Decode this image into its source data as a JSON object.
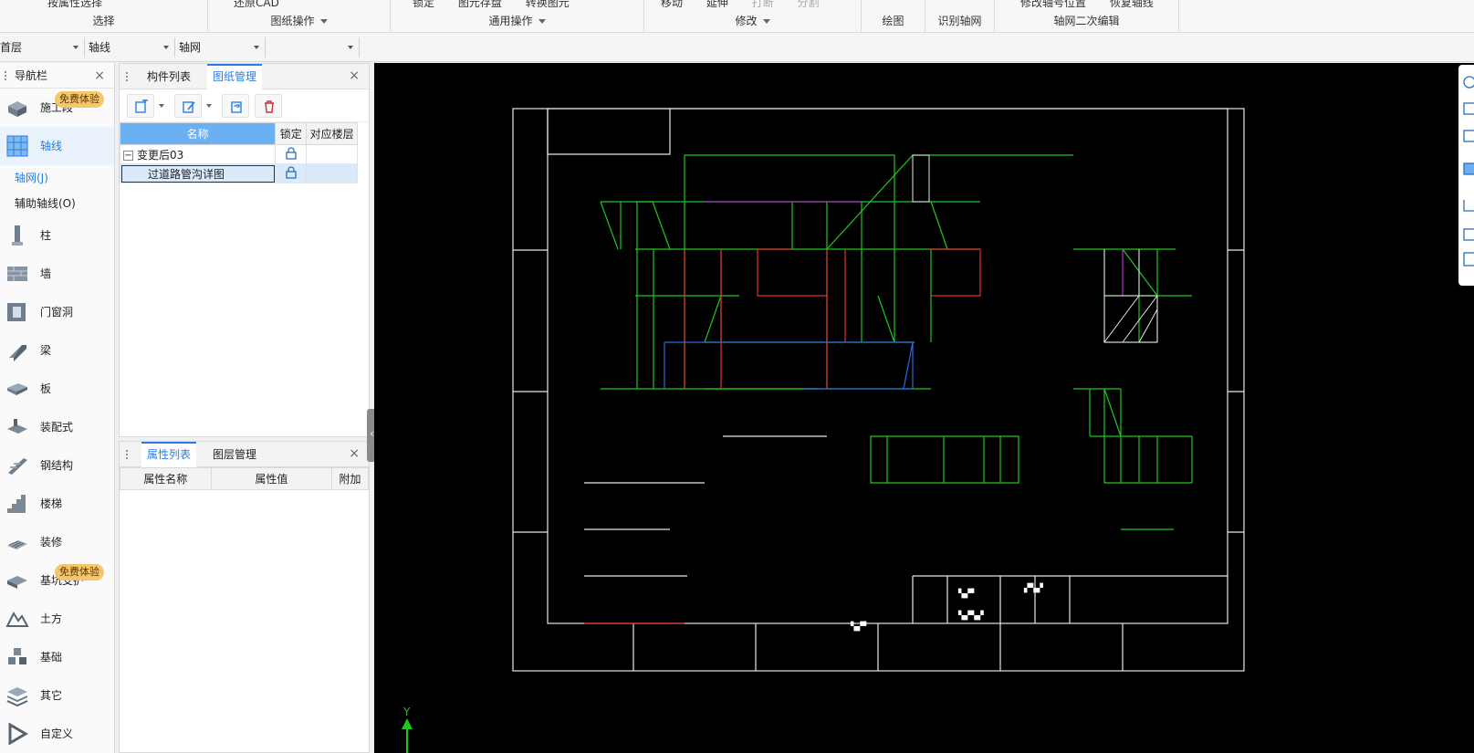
{
  "ribbon": {
    "groups": [
      {
        "cmds": [
          "按属性选择"
        ],
        "title": "选择"
      },
      {
        "cmds": [
          "还原CAD"
        ],
        "title": "图纸操作"
      },
      {
        "cmds": [
          "锁定",
          "图元存盘",
          "转换图元"
        ],
        "title": "通用操作"
      },
      {
        "cmds": [
          "移动",
          "延伸",
          "打断",
          "分割"
        ],
        "title": "修改"
      },
      {
        "cmds": [],
        "title": "绘图"
      },
      {
        "cmds": [],
        "title": "识别轴网"
      },
      {
        "cmds": [
          "修改轴号位置",
          "恢复轴线"
        ],
        "title": "轴网二次编辑"
      }
    ]
  },
  "selectors": {
    "floor": "首层",
    "category": "轴线",
    "type": "轴网",
    "extra": ""
  },
  "nav": {
    "title": "导航栏",
    "badge": "免费体验",
    "items": [
      {
        "label": "施工段",
        "icon": "construction-stage-icon"
      },
      {
        "label": "轴线",
        "icon": "axis-grid-icon"
      },
      {
        "label": "柱",
        "icon": "column-icon"
      },
      {
        "label": "墙",
        "icon": "wall-icon"
      },
      {
        "label": "门窗洞",
        "icon": "door-window-icon"
      },
      {
        "label": "梁",
        "icon": "beam-icon"
      },
      {
        "label": "板",
        "icon": "slab-icon"
      },
      {
        "label": "装配式",
        "icon": "prefab-icon"
      },
      {
        "label": "钢结构",
        "icon": "steel-structure-icon"
      },
      {
        "label": "楼梯",
        "icon": "stair-icon"
      },
      {
        "label": "装修",
        "icon": "decoration-icon"
      },
      {
        "label": "基坑支护",
        "icon": "foundation-pit-icon"
      },
      {
        "label": "土方",
        "icon": "earthwork-icon"
      },
      {
        "label": "基础",
        "icon": "foundation-icon"
      },
      {
        "label": "其它",
        "icon": "other-icon"
      },
      {
        "label": "自定义",
        "icon": "custom-icon"
      }
    ],
    "sub_items": [
      "轴网(J)",
      "辅助轴线(O)"
    ]
  },
  "drawing_panel": {
    "tabs": [
      "构件列表",
      "图纸管理"
    ],
    "columns": [
      "名称",
      "锁定",
      "对应楼层"
    ],
    "rows": [
      {
        "name": "变更后03",
        "floor": ""
      },
      {
        "name": "过道路管沟详图",
        "floor": ""
      }
    ]
  },
  "property_panel": {
    "tabs": [
      "属性列表",
      "图层管理"
    ],
    "columns": [
      "属性名称",
      "属性值",
      "附加"
    ]
  },
  "canvas": {
    "axis_label": "Y"
  }
}
